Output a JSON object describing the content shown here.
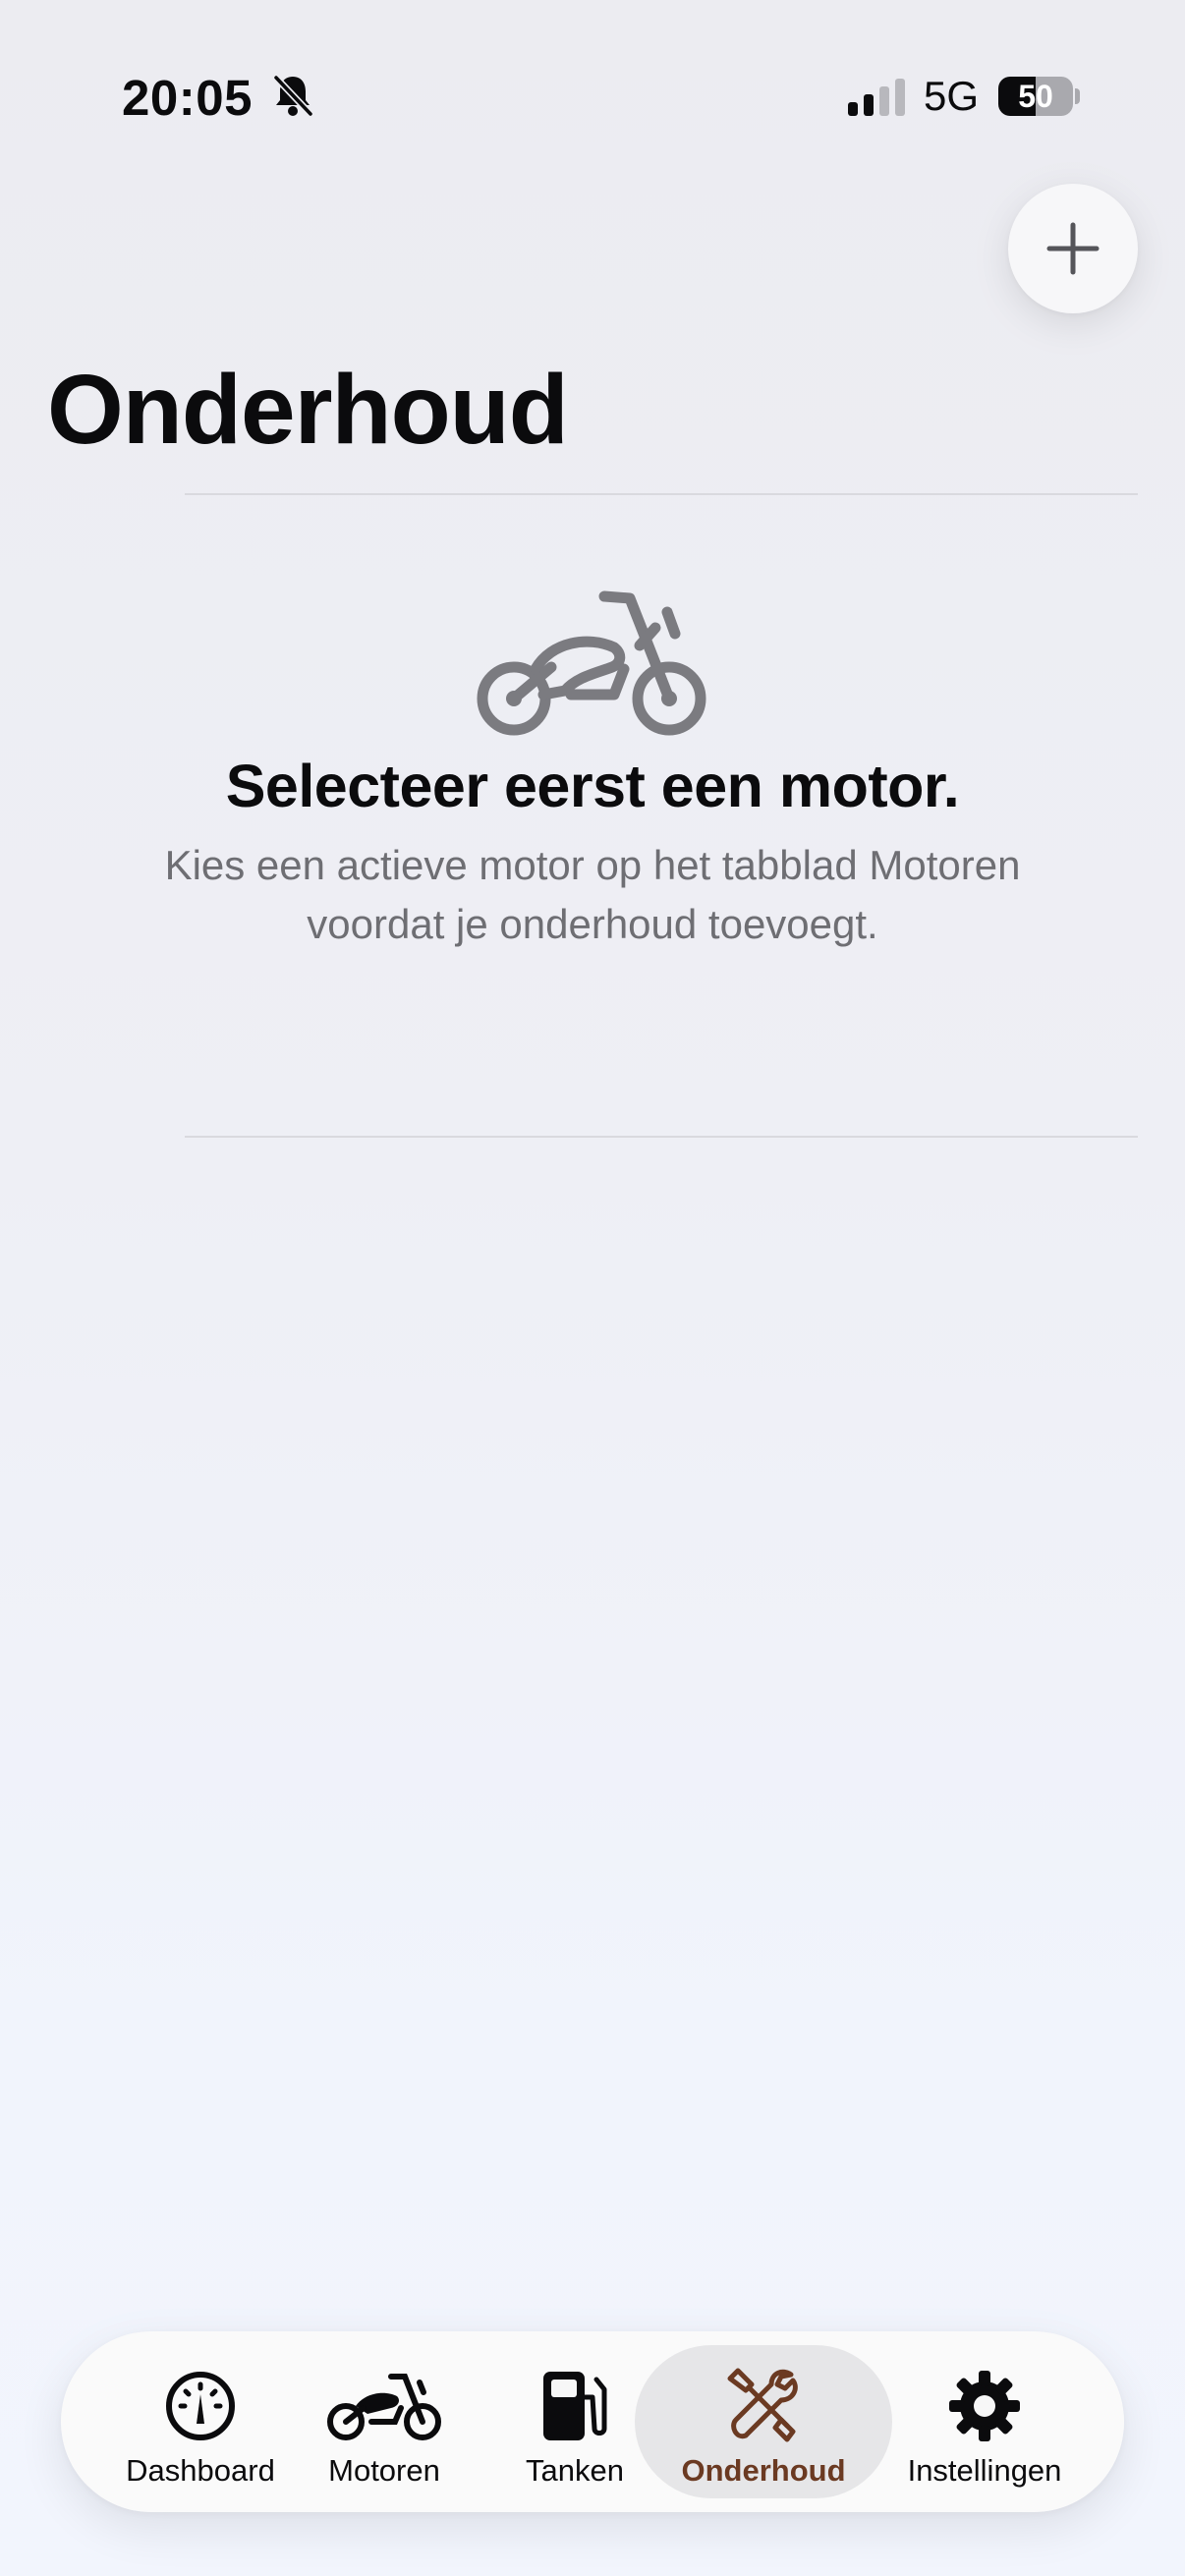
{
  "status_bar": {
    "time": "20:05",
    "network": "5G",
    "battery": "50"
  },
  "header": {
    "title": "Onderhoud",
    "add_icon": "plus-icon"
  },
  "empty_state": {
    "icon": "motorcycle-icon",
    "title": "Selecteer eerst een motor.",
    "description": "Kies een actieve motor op het tabblad Motoren voordat je onderhoud toevoegt."
  },
  "tab_bar": {
    "active_tab": "Onderhoud",
    "accent_color": "#6b3a22",
    "tabs": [
      {
        "label": "Dashboard",
        "icon": "gauge-icon"
      },
      {
        "label": "Motoren",
        "icon": "motorcycle-icon"
      },
      {
        "label": "Tanken",
        "icon": "fuel-pump-icon"
      },
      {
        "label": "Onderhoud",
        "icon": "wrench-screwdriver-icon"
      },
      {
        "label": "Instellingen",
        "icon": "gear-icon"
      }
    ]
  }
}
